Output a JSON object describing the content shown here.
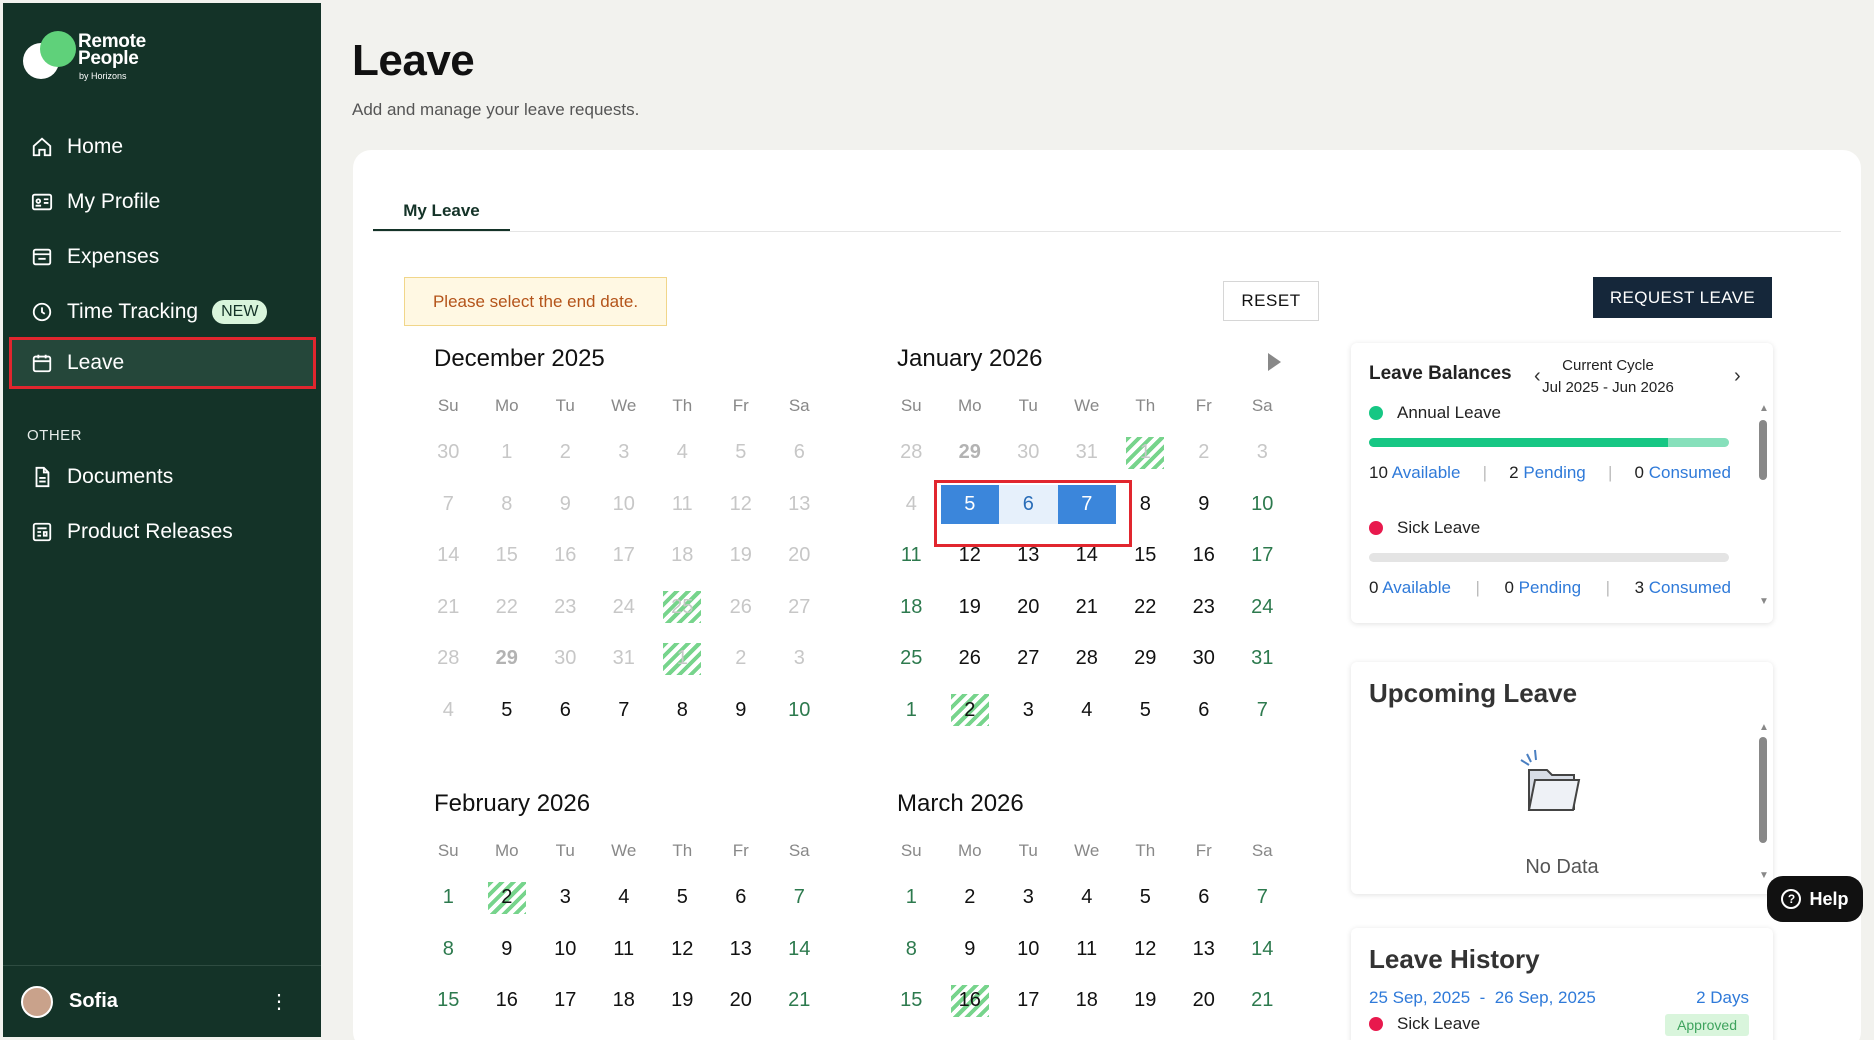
{
  "sidebar": {
    "logo_line1": "Remote",
    "logo_line2": "People",
    "logo_by": "by Horizons",
    "items": [
      {
        "label": "Home"
      },
      {
        "label": "My Profile"
      },
      {
        "label": "Expenses"
      },
      {
        "label": "Time Tracking",
        "badge": "NEW"
      },
      {
        "label": "Leave"
      }
    ],
    "other_heading": "OTHER",
    "other_items": [
      {
        "label": "Documents"
      },
      {
        "label": "Product Releases"
      }
    ],
    "user_name": "Sofia"
  },
  "page": {
    "title": "Leave",
    "subtitle": "Add and manage your leave requests."
  },
  "tabs": [
    {
      "label": "My Leave"
    }
  ],
  "alert": "Please select the end date.",
  "reset_label": "RESET",
  "request_label": "REQUEST LEAVE",
  "calendar": {
    "dow": [
      "Su",
      "Mo",
      "Tu",
      "We",
      "Th",
      "Fr",
      "Sa"
    ],
    "months": [
      {
        "title": "December 2025",
        "days": [
          [
            "30",
            "m"
          ],
          [
            "1",
            "m"
          ],
          [
            "2",
            "m"
          ],
          [
            "3",
            "m"
          ],
          [
            "4",
            "m"
          ],
          [
            "5",
            "m"
          ],
          [
            "6",
            "m"
          ],
          [
            "7",
            "m"
          ],
          [
            "8",
            "m"
          ],
          [
            "9",
            "m"
          ],
          [
            "10",
            "m"
          ],
          [
            "11",
            "m"
          ],
          [
            "12",
            "m"
          ],
          [
            "13",
            "m"
          ],
          [
            "14",
            "m"
          ],
          [
            "15",
            "m"
          ],
          [
            "16",
            "m"
          ],
          [
            "17",
            "m"
          ],
          [
            "18",
            "m"
          ],
          [
            "19",
            "m"
          ],
          [
            "20",
            "m"
          ],
          [
            "21",
            "m"
          ],
          [
            "22",
            "m"
          ],
          [
            "23",
            "m"
          ],
          [
            "24",
            "m"
          ],
          [
            "25",
            "mh"
          ],
          [
            "26",
            "m"
          ],
          [
            "27",
            "m"
          ],
          [
            "28",
            "m"
          ],
          [
            "29",
            "b"
          ],
          [
            "30",
            "m"
          ],
          [
            "31",
            "m"
          ],
          [
            "1",
            "mh"
          ],
          [
            "2",
            "m"
          ],
          [
            "3",
            "m"
          ],
          [
            "4",
            "m"
          ],
          [
            "5",
            "n"
          ],
          [
            "6",
            "n"
          ],
          [
            "7",
            "n"
          ],
          [
            "8",
            "n"
          ],
          [
            "9",
            "n"
          ],
          [
            "10",
            "w"
          ]
        ]
      },
      {
        "title": "January 2026",
        "days": [
          [
            "28",
            "m"
          ],
          [
            "29",
            "b"
          ],
          [
            "30",
            "m"
          ],
          [
            "31",
            "m"
          ],
          [
            "1",
            "mh"
          ],
          [
            "2",
            "m"
          ],
          [
            "3",
            "m"
          ],
          [
            "4",
            "m"
          ],
          [
            "5",
            "s"
          ],
          [
            "6",
            "r"
          ],
          [
            "7",
            "s"
          ],
          [
            "8",
            "n"
          ],
          [
            "9",
            "n"
          ],
          [
            "10",
            "w"
          ],
          [
            "11",
            "w"
          ],
          [
            "12",
            "n"
          ],
          [
            "13",
            "n"
          ],
          [
            "14",
            "n"
          ],
          [
            "15",
            "n"
          ],
          [
            "16",
            "n"
          ],
          [
            "17",
            "w"
          ],
          [
            "18",
            "w"
          ],
          [
            "19",
            "n"
          ],
          [
            "20",
            "n"
          ],
          [
            "21",
            "n"
          ],
          [
            "22",
            "n"
          ],
          [
            "23",
            "n"
          ],
          [
            "24",
            "w"
          ],
          [
            "25",
            "w"
          ],
          [
            "26",
            "n"
          ],
          [
            "27",
            "n"
          ],
          [
            "28",
            "n"
          ],
          [
            "29",
            "n"
          ],
          [
            "30",
            "n"
          ],
          [
            "31",
            "w"
          ],
          [
            "1",
            "w"
          ],
          [
            "2",
            "h"
          ],
          [
            "3",
            "n"
          ],
          [
            "4",
            "n"
          ],
          [
            "5",
            "n"
          ],
          [
            "6",
            "n"
          ],
          [
            "7",
            "w"
          ]
        ]
      },
      {
        "title": "February 2026",
        "days": [
          [
            "1",
            "w"
          ],
          [
            "2",
            "h"
          ],
          [
            "3",
            "n"
          ],
          [
            "4",
            "n"
          ],
          [
            "5",
            "n"
          ],
          [
            "6",
            "n"
          ],
          [
            "7",
            "w"
          ],
          [
            "8",
            "w"
          ],
          [
            "9",
            "n"
          ],
          [
            "10",
            "n"
          ],
          [
            "11",
            "n"
          ],
          [
            "12",
            "n"
          ],
          [
            "13",
            "n"
          ],
          [
            "14",
            "w"
          ],
          [
            "15",
            "w"
          ],
          [
            "16",
            "n"
          ],
          [
            "17",
            "n"
          ],
          [
            "18",
            "n"
          ],
          [
            "19",
            "n"
          ],
          [
            "20",
            "n"
          ],
          [
            "21",
            "w"
          ]
        ]
      },
      {
        "title": "March 2026",
        "days": [
          [
            "1",
            "w"
          ],
          [
            "2",
            "n"
          ],
          [
            "3",
            "n"
          ],
          [
            "4",
            "n"
          ],
          [
            "5",
            "n"
          ],
          [
            "6",
            "n"
          ],
          [
            "7",
            "w"
          ],
          [
            "8",
            "w"
          ],
          [
            "9",
            "n"
          ],
          [
            "10",
            "n"
          ],
          [
            "11",
            "n"
          ],
          [
            "12",
            "n"
          ],
          [
            "13",
            "n"
          ],
          [
            "14",
            "w"
          ],
          [
            "15",
            "w"
          ],
          [
            "16",
            "h"
          ],
          [
            "17",
            "n"
          ],
          [
            "18",
            "n"
          ],
          [
            "19",
            "n"
          ],
          [
            "20",
            "n"
          ],
          [
            "21",
            "w"
          ]
        ]
      }
    ]
  },
  "balances": {
    "title": "Leave Balances",
    "cycle_label": "Current Cycle",
    "cycle_range": "Jul 2025 - Jun 2026",
    "types": [
      {
        "name": "Annual Leave",
        "color": "#16c784",
        "available": "10",
        "pending": "2",
        "consumed": "0",
        "available_frac": 0.83,
        "pending_frac": 0.17
      },
      {
        "name": "Sick Leave",
        "color": "#e8194d",
        "available": "0",
        "pending": "0",
        "consumed": "3",
        "available_frac": 0,
        "pending_frac": 0
      }
    ],
    "available_label": "Available",
    "pending_label": "Pending",
    "consumed_label": "Consumed"
  },
  "upcoming": {
    "title": "Upcoming Leave",
    "empty": "No Data"
  },
  "history": {
    "title": "Leave History",
    "entry": {
      "dates": "25 Sep, 2025  -  26 Sep, 2025",
      "days": "2 Days",
      "type": "Sick Leave",
      "status": "Approved",
      "type_color": "#e8194d"
    }
  },
  "help_label": "Help"
}
